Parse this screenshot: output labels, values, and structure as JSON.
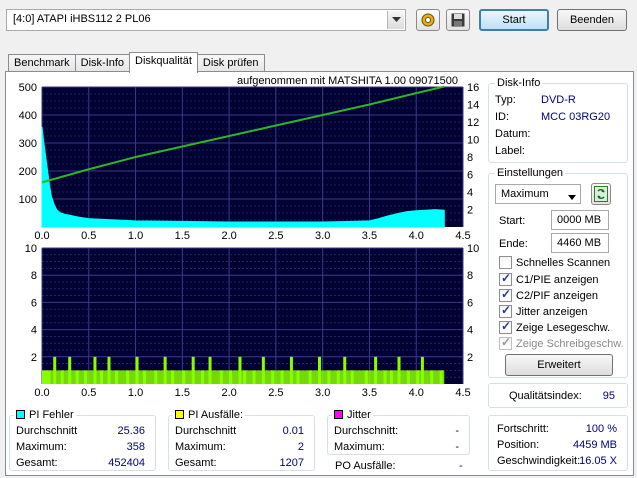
{
  "toolbar": {
    "drive_value": "[4:0]   ATAPI iHBS112   2 PL06",
    "start_label": "Start",
    "exit_label": "Beenden"
  },
  "tabs": [
    {
      "label": "Benchmark",
      "active": false
    },
    {
      "label": "Disk-Info",
      "active": false
    },
    {
      "label": "Diskqualität",
      "active": true
    },
    {
      "label": "Disk prüfen",
      "active": false
    }
  ],
  "charts": {
    "caption": "aufgenommen mit MATSHITA 1.00 09071500",
    "colors": {
      "background": "#000033",
      "grid": "#3a3a8a",
      "pie": "#00ffff",
      "speed": "#2bb52b",
      "pif": "#88ff00"
    }
  },
  "chart_data": [
    {
      "type": "area",
      "name": "PI Fehler",
      "xlim": [
        0,
        4.5
      ],
      "x_ticks": [
        "0.0",
        "0.5",
        "1.0",
        "1.5",
        "2.0",
        "2.5",
        "3.0",
        "3.5",
        "4.0",
        "4.5"
      ],
      "ylim_left": [
        0,
        500
      ],
      "y_ticks_left": [
        "100",
        "200",
        "300",
        "400",
        "500"
      ],
      "ylim_right": [
        0,
        16
      ],
      "y_ticks_right": [
        "2",
        "4",
        "6",
        "8",
        "10",
        "12",
        "14",
        "16"
      ],
      "series": [
        {
          "name": "PI Fehler",
          "x": [
            0.0,
            0.02,
            0.04,
            0.06,
            0.08,
            0.1,
            0.13,
            0.16,
            0.2,
            0.25,
            0.3,
            0.35,
            0.4,
            0.5,
            0.6,
            0.8,
            1.0,
            1.5,
            2.0,
            2.5,
            3.0,
            3.3,
            3.5,
            3.6,
            3.7,
            3.8,
            3.9,
            4.0,
            4.1,
            4.2,
            4.3
          ],
          "y": [
            358,
            300,
            250,
            200,
            150,
            110,
            80,
            60,
            50,
            45,
            42,
            38,
            35,
            30,
            28,
            25,
            22,
            20,
            18,
            18,
            18,
            20,
            22,
            30,
            40,
            48,
            55,
            58,
            60,
            62,
            60
          ]
        },
        {
          "name": "Lesegeschwindigkeit",
          "x": [
            0.0,
            0.5,
            1.0,
            1.5,
            2.0,
            2.5,
            3.0,
            3.5,
            4.0,
            4.3
          ],
          "y": [
            5.1,
            6.6,
            8.0,
            9.2,
            10.4,
            11.6,
            12.8,
            14.0,
            15.3,
            16.05
          ]
        }
      ]
    },
    {
      "type": "bar",
      "name": "PI Ausfälle",
      "xlim": [
        0,
        4.5
      ],
      "x_ticks": [
        "0.0",
        "0.5",
        "1.0",
        "1.5",
        "2.0",
        "2.5",
        "3.0",
        "3.5",
        "4.0",
        "4.5"
      ],
      "ylim_left": [
        0,
        10
      ],
      "y_ticks_left": [
        "2",
        "4",
        "6",
        "8",
        "10"
      ],
      "y_ticks_right": [
        "2",
        "4",
        "6",
        "8",
        "10"
      ],
      "series": [
        {
          "name": "PI Ausfälle",
          "x": [
            0.0,
            0.03,
            0.06,
            0.12,
            0.2,
            0.28,
            0.36,
            0.45,
            0.55,
            0.62,
            0.7,
            0.78,
            0.9,
            1.0,
            1.08,
            1.2,
            1.3,
            1.38,
            1.5,
            1.6,
            1.7,
            1.78,
            1.9,
            2.0,
            2.1,
            2.15,
            2.25,
            2.35,
            2.45,
            2.55,
            2.65,
            2.72,
            2.85,
            2.95,
            3.05,
            3.15,
            3.22,
            3.3,
            3.45,
            3.55,
            3.65,
            3.72,
            3.8,
            3.9,
            4.0,
            4.05,
            4.15,
            4.25
          ],
          "y": [
            1,
            1,
            1,
            2,
            1,
            2,
            1,
            1,
            2,
            1,
            2,
            1,
            1,
            2,
            1,
            1,
            2,
            1,
            1,
            2,
            1,
            2,
            1,
            1,
            2,
            1,
            1,
            2,
            1,
            1,
            2,
            1,
            1,
            2,
            1,
            1,
            2,
            1,
            1,
            2,
            1,
            1,
            2,
            1,
            1,
            2,
            1,
            1
          ]
        }
      ]
    }
  ],
  "disk_info": {
    "title": "Disk-Info",
    "rows": [
      {
        "label": "Typ:",
        "value": "DVD-R"
      },
      {
        "label": "ID:",
        "value": "MCC 03RG20"
      },
      {
        "label": "Datum:",
        "value": ""
      },
      {
        "label": "Label:",
        "value": ""
      }
    ]
  },
  "settings": {
    "title": "Einstellungen",
    "speed_value": "Maximum",
    "start_label": "Start:",
    "start_value": "0000 MB",
    "end_label": "Ende:",
    "end_value": "4460 MB",
    "checks": [
      {
        "label": "Schnelles Scannen",
        "checked": false,
        "disabled": false
      },
      {
        "label": "C1/PIE anzeigen",
        "checked": true,
        "disabled": false
      },
      {
        "label": "C2/PIF anzeigen",
        "checked": true,
        "disabled": false
      },
      {
        "label": "Jitter anzeigen",
        "checked": true,
        "disabled": false
      },
      {
        "label": "Zeige Lesegeschw.",
        "checked": true,
        "disabled": false
      },
      {
        "label": "Zeige Schreibgeschw.",
        "checked": true,
        "disabled": true
      }
    ],
    "advanced_label": "Erweitert"
  },
  "quality": {
    "label": "Qualitätsindex:",
    "value": "95"
  },
  "progress": {
    "rows": [
      {
        "label": "Fortschritt:",
        "value": "100 %"
      },
      {
        "label": "Position:",
        "value": "4459 MB"
      },
      {
        "label": "Geschwindigkeit:",
        "value": "16.05 X"
      }
    ]
  },
  "stats": {
    "pi_errors": {
      "title": "PI Fehler",
      "color": "#00ffff",
      "rows": [
        {
          "label": "Durchschnitt",
          "value": "25.36"
        },
        {
          "label": "Maximum:",
          "value": "358"
        },
        {
          "label": "Gesamt:",
          "value": "452404"
        }
      ]
    },
    "pi_failures": {
      "title": "PI Ausfälle:",
      "color": "#ffff00",
      "rows": [
        {
          "label": "Durchschnitt",
          "value": "0.01"
        },
        {
          "label": "Maximum:",
          "value": "2"
        },
        {
          "label": "Gesamt:",
          "value": "1207"
        }
      ]
    },
    "jitter": {
      "title": "Jitter",
      "color": "#ff00ff",
      "rows": [
        {
          "label": "Durchschnitt:",
          "value": "-"
        },
        {
          "label": "Maximum:",
          "value": "-"
        }
      ],
      "po_label": "PO Ausfälle:",
      "po_value": "-"
    }
  }
}
